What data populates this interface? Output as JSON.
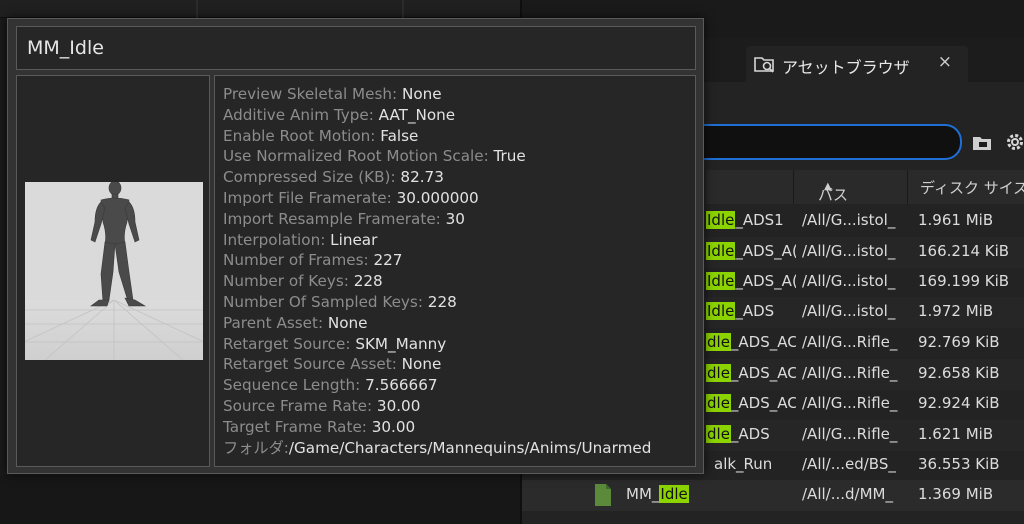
{
  "tooltip": {
    "title": "MM_Idle",
    "properties": [
      {
        "key": "Preview Skeletal Mesh: ",
        "value": "None"
      },
      {
        "key": "Additive Anim Type: ",
        "value": "AAT_None"
      },
      {
        "key": "Enable Root Motion: ",
        "value": "False"
      },
      {
        "key": "Use Normalized Root Motion Scale: ",
        "value": "True"
      },
      {
        "key": "Compressed Size (KB): ",
        "value": "82.73"
      },
      {
        "key": "Import File Framerate: ",
        "value": "30.000000"
      },
      {
        "key": "Import Resample Framerate: ",
        "value": "30"
      },
      {
        "key": "Interpolation: ",
        "value": "Linear"
      },
      {
        "key": "Number of Frames: ",
        "value": "227"
      },
      {
        "key": "Number of Keys: ",
        "value": "228"
      },
      {
        "key": "Number Of Sampled Keys: ",
        "value": "228"
      },
      {
        "key": "Parent Asset: ",
        "value": "None"
      },
      {
        "key": "Retarget Source: ",
        "value": "SKM_Manny"
      },
      {
        "key": "Retarget Source Asset: ",
        "value": "None"
      },
      {
        "key": "Sequence Length: ",
        "value": "7.566667"
      },
      {
        "key": "Source Frame Rate: ",
        "value": "30.00"
      },
      {
        "key": "Target Frame Rate: ",
        "value": "30.00"
      },
      {
        "key": "フォルダ:",
        "value": "/Game/Characters/Mannequins/Anims/Unarmed"
      }
    ]
  },
  "content_browser": {
    "tab_label": "アセットブラウザ",
    "tab_close": "×",
    "search_value": "",
    "columns": {
      "path": "パス",
      "size": "ディスク サイズ"
    },
    "highlight_color": "#8cd400",
    "rows": [
      {
        "pre": "",
        "hl": "Idle",
        "post": "_ADS1",
        "path": "/All/G...istol_",
        "size": "1.961 MiB"
      },
      {
        "pre": "",
        "hl": "Idle",
        "post": "_ADS_A(",
        "path": "/All/G...istol_",
        "size": "166.214 KiB"
      },
      {
        "pre": "",
        "hl": "Idle",
        "post": "_ADS_A(",
        "path": "/All/G...istol_",
        "size": "169.199 KiB"
      },
      {
        "pre": "",
        "hl": "Idle",
        "post": "_ADS",
        "path": "/All/G...istol_",
        "size": "1.972 MiB"
      },
      {
        "pre": "",
        "hl": "dle",
        "post": "_ADS_AC",
        "path": "/All/G...Rifle_",
        "size": "92.769 KiB"
      },
      {
        "pre": "",
        "hl": "dle",
        "post": "_ADS_AC",
        "path": "/All/G...Rifle_",
        "size": "92.658 KiB"
      },
      {
        "pre": "",
        "hl": "dle",
        "post": "_ADS_AC",
        "path": "/All/G...Rifle_",
        "size": "92.924 KiB"
      },
      {
        "pre": "",
        "hl": "dle",
        "post": "_ADS",
        "path": "/All/G...Rifle_",
        "size": "1.621 MiB"
      },
      {
        "pre": "alk_Run",
        "hl": "",
        "post": "",
        "path": "/All/...ed/BS_",
        "size": "36.553 KiB"
      },
      {
        "pre": "MM_",
        "hl": "Idle",
        "post": "",
        "path": "/All/...d/MM_",
        "size": "1.369 MiB"
      }
    ]
  }
}
